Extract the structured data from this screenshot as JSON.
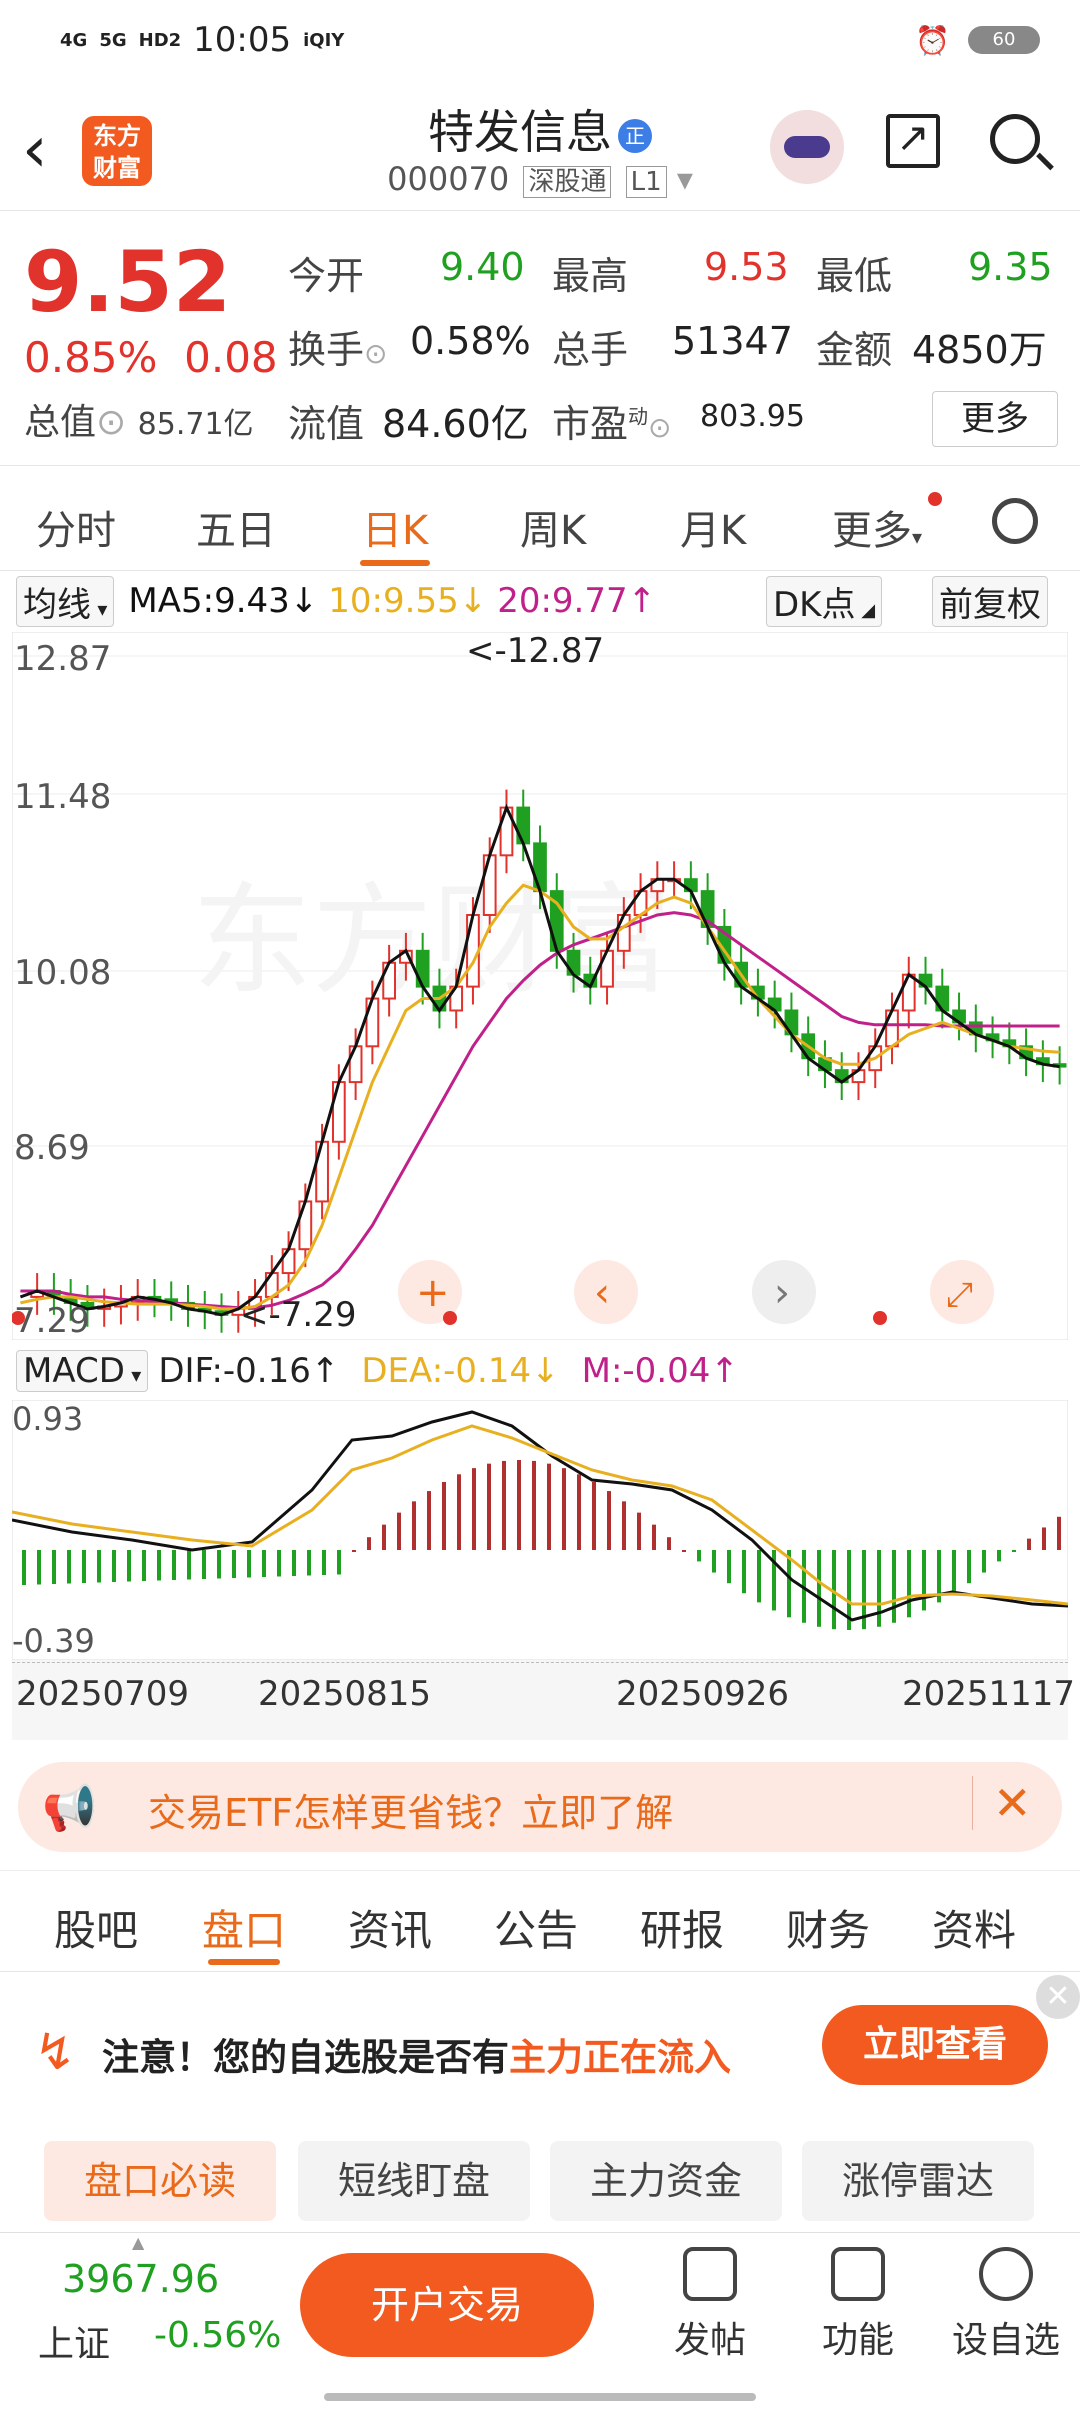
{
  "status": {
    "signal": "4G",
    "signal2": "5G",
    "hd": "HD2",
    "time": "10:05",
    "app": "iQIY",
    "battery": "60"
  },
  "header": {
    "logo": "东方财富",
    "name": "特发信息",
    "badge": "正",
    "code": "000070",
    "market_tag": "深股通",
    "level_tag": "L1"
  },
  "quote": {
    "price": "9.52",
    "change_pct": "0.85%",
    "change": "0.08",
    "mcap_label": "总值",
    "mcap": "85.71亿",
    "open_label": "今开",
    "open": "9.40",
    "high_label": "最高",
    "high": "9.53",
    "low_label": "最低",
    "low": "9.35",
    "turnover_label": "换手",
    "turnover": "0.58%",
    "volume_label": "总手",
    "volume": "51347",
    "amount_label": "金额",
    "amount": "4850万",
    "float_label": "流值",
    "float": "84.60亿",
    "pe_label": "市盈",
    "pe_sup": "动",
    "pe": "803.95",
    "more": "更多"
  },
  "tabs": [
    "分时",
    "五日",
    "日K",
    "周K",
    "月K",
    "更多"
  ],
  "ma": {
    "selector": "均线",
    "ma5": "MA5:9.43↓",
    "ma10": "10:9.55↓",
    "ma20": "20:9.77↑",
    "dk": "DK点",
    "adjust": "前复权"
  },
  "chart_data": {
    "type": "candlestick",
    "y_ticks": [
      "12.87",
      "11.48",
      "10.08",
      "8.69",
      "7.29"
    ],
    "ylim": [
      7.29,
      12.87
    ],
    "max_label": "<-12.87",
    "min_label": "<-7.29",
    "ma5": [
      7.5,
      7.55,
      7.5,
      7.45,
      7.4,
      7.42,
      7.45,
      7.5,
      7.48,
      7.45,
      7.4,
      7.38,
      7.35,
      7.4,
      7.5,
      7.7,
      7.9,
      8.3,
      8.8,
      9.3,
      9.6,
      10.0,
      10.3,
      10.4,
      10.1,
      9.9,
      10.1,
      10.7,
      11.2,
      11.6,
      11.3,
      10.9,
      10.4,
      10.2,
      10.1,
      10.4,
      10.7,
      10.9,
      11.0,
      11.0,
      10.9,
      10.6,
      10.3,
      10.1,
      10.0,
      9.9,
      9.7,
      9.5,
      9.4,
      9.3,
      9.4,
      9.6,
      9.9,
      10.2,
      10.1,
      9.9,
      9.8,
      9.7,
      9.65,
      9.6,
      9.5,
      9.45,
      9.43
    ],
    "ma10": [
      7.45,
      7.48,
      7.5,
      7.5,
      7.48,
      7.46,
      7.45,
      7.44,
      7.44,
      7.44,
      7.43,
      7.42,
      7.4,
      7.4,
      7.42,
      7.5,
      7.6,
      7.8,
      8.1,
      8.5,
      8.9,
      9.3,
      9.6,
      9.9,
      10.0,
      10.0,
      10.1,
      10.3,
      10.6,
      10.8,
      10.95,
      10.9,
      10.8,
      10.6,
      10.5,
      10.5,
      10.6,
      10.7,
      10.8,
      10.85,
      10.8,
      10.6,
      10.4,
      10.2,
      10.0,
      9.85,
      9.7,
      9.6,
      9.5,
      9.45,
      9.45,
      9.5,
      9.6,
      9.7,
      9.75,
      9.8,
      9.75,
      9.7,
      9.65,
      9.6,
      9.58,
      9.56,
      9.55
    ],
    "ma20": [
      7.55,
      7.55,
      7.55,
      7.52,
      7.5,
      7.5,
      7.48,
      7.47,
      7.46,
      7.45,
      7.44,
      7.43,
      7.42,
      7.41,
      7.41,
      7.43,
      7.47,
      7.53,
      7.6,
      7.72,
      7.9,
      8.1,
      8.35,
      8.6,
      8.85,
      9.1,
      9.35,
      9.6,
      9.8,
      10.0,
      10.15,
      10.28,
      10.38,
      10.45,
      10.5,
      10.55,
      10.6,
      10.65,
      10.7,
      10.72,
      10.7,
      10.65,
      10.55,
      10.45,
      10.35,
      10.25,
      10.15,
      10.05,
      9.95,
      9.85,
      9.8,
      9.78,
      9.78,
      9.78,
      9.78,
      9.77,
      9.77,
      9.77,
      9.77,
      9.77,
      9.77,
      9.77,
      9.77
    ]
  },
  "macd": {
    "selector": "MACD",
    "dif": "DIF:-0.16↑",
    "dea": "DEA:-0.14↓",
    "m": "M:-0.04↑",
    "y_top": "0.93",
    "y_bottom": "-0.39"
  },
  "dates": [
    "20250709",
    "20250815",
    "20250926",
    "20251117"
  ],
  "ad": {
    "text": "交易ETF怎样更省钱？立即了解"
  },
  "info_tabs": [
    "股吧",
    "盘口",
    "资讯",
    "公告",
    "研报",
    "财务",
    "资料"
  ],
  "notice": {
    "prefix": "注意！",
    "text1": "您的自选股是否有",
    "text2": "主力正在流入",
    "button": "立即查看"
  },
  "sub_tabs": [
    "盘口必读",
    "短线盯盘",
    "主力资金",
    "涨停雷达"
  ],
  "bottom": {
    "index_value": "3967.96",
    "index_name": "上证",
    "index_change": "-0.56%",
    "trade": "开户交易",
    "post": "发帖",
    "func": "功能",
    "watch": "设自选"
  },
  "colors": {
    "up": "#e1322c",
    "down": "#20a020",
    "accent": "#f25a1f",
    "ma5": "#111111",
    "ma10": "#e8b020",
    "ma20": "#c0208a"
  }
}
